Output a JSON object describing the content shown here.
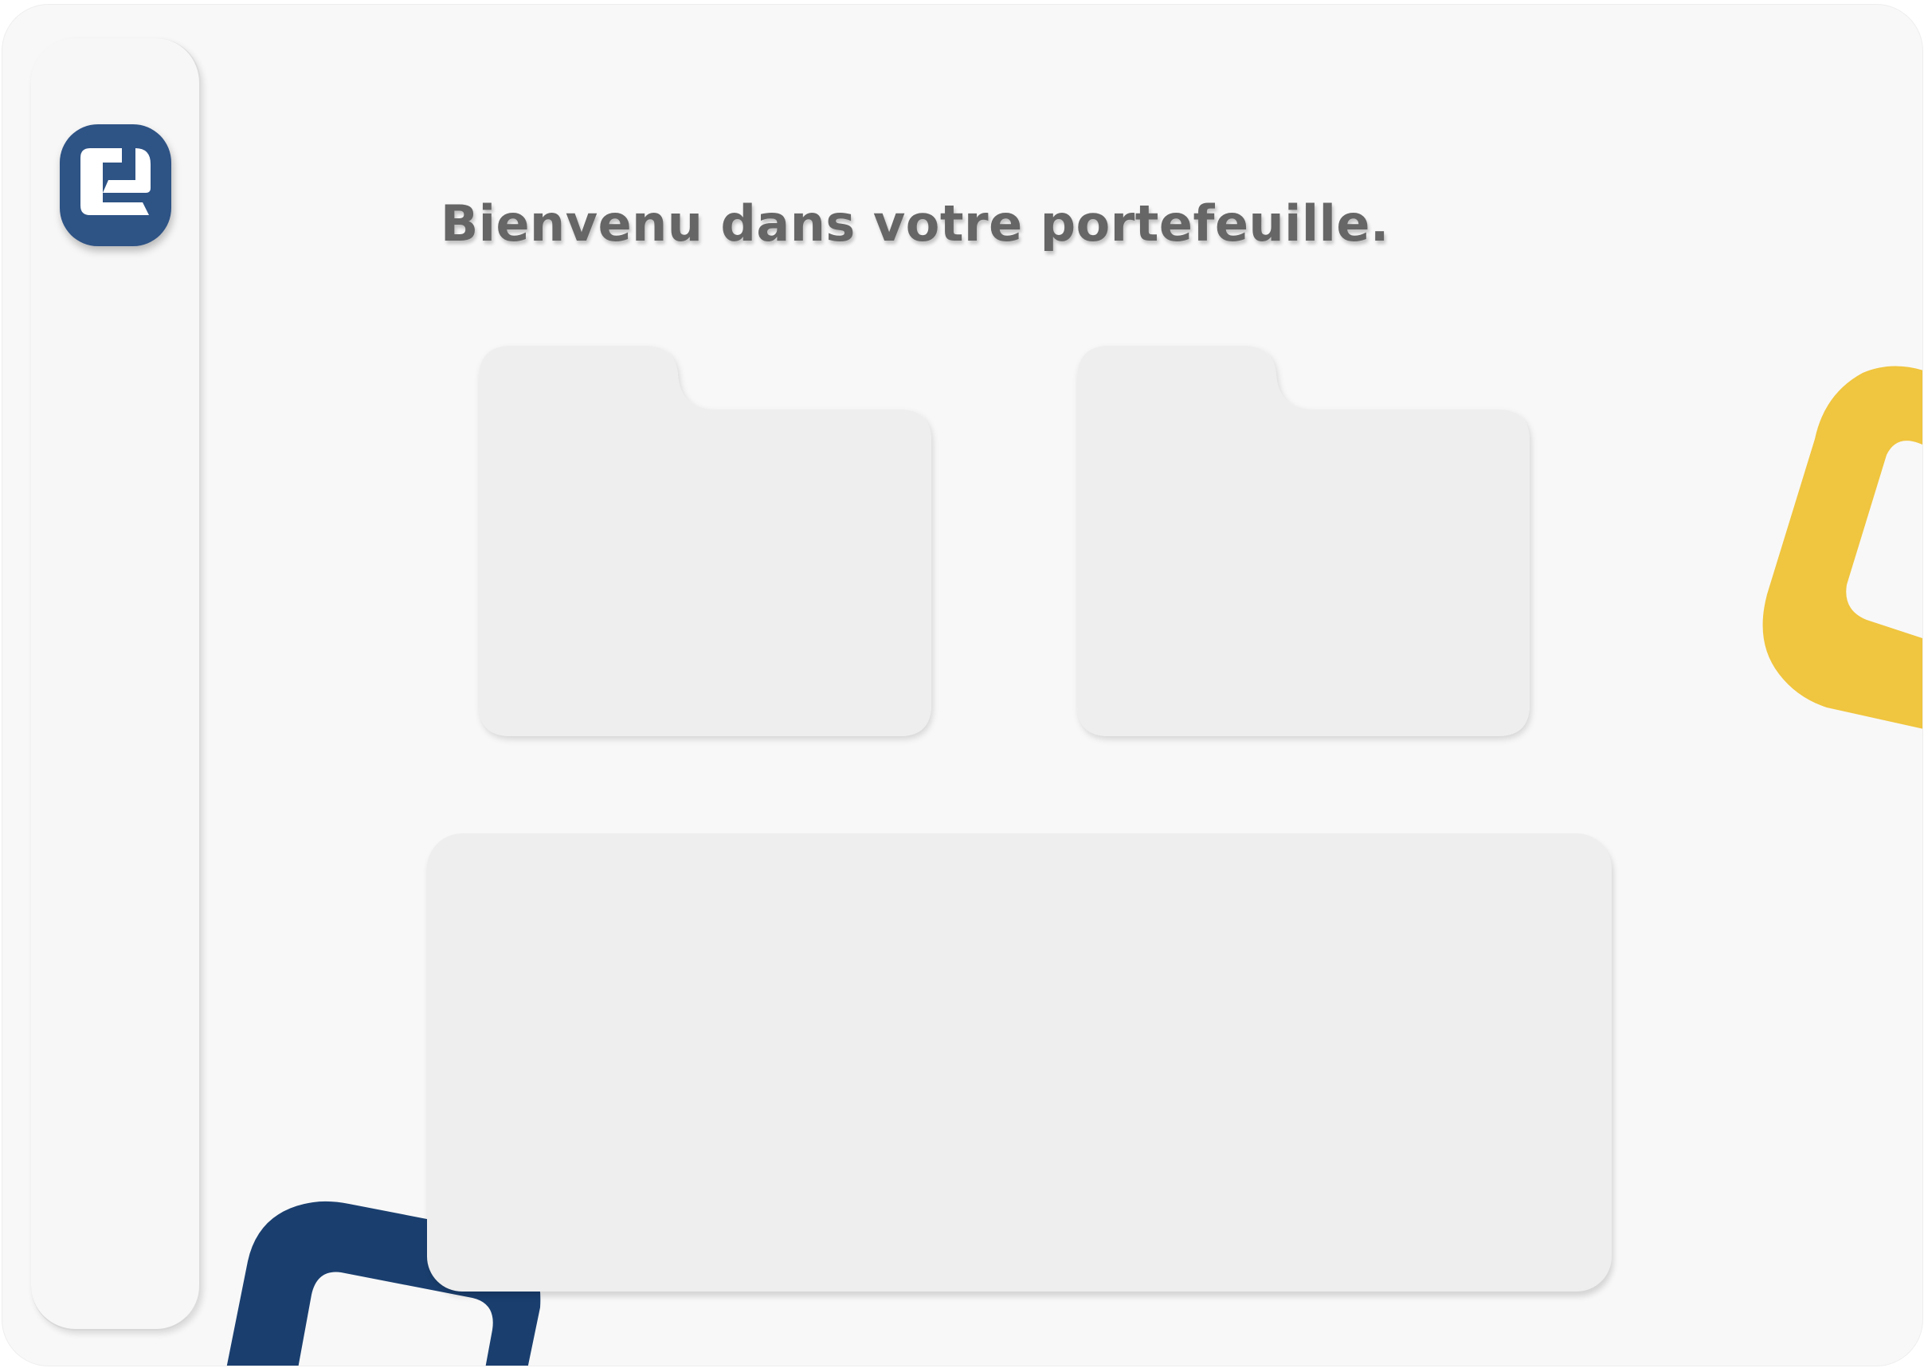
{
  "header": {
    "title": "Bienvenu dans votre portefeuille."
  },
  "sidebar": {
    "logo_icon": "wallet-logo-icon"
  },
  "cards": [
    {
      "icon": "folder-card"
    },
    {
      "icon": "folder-card"
    }
  ],
  "colors": {
    "brand_blue": "#2e5385",
    "deco_blue": "#1a3f6f",
    "deco_yellow": "#f0c53f",
    "background": "#f8f8f8",
    "card": "#eeeeee",
    "title_text": "#666666"
  }
}
